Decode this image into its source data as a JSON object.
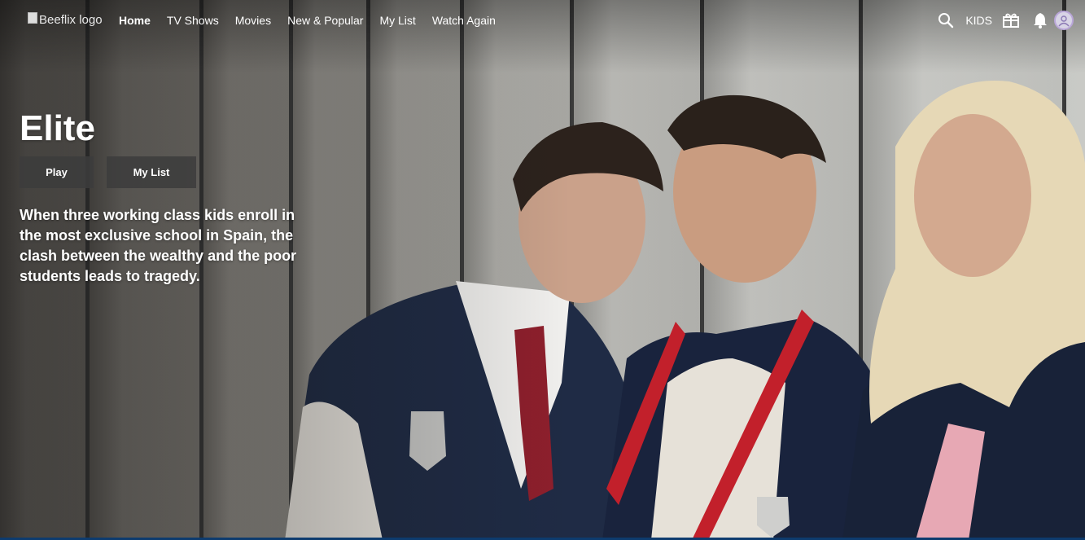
{
  "logo": {
    "alt_text": "Beeflix logo"
  },
  "nav": {
    "links": [
      {
        "label": "Home",
        "active": true
      },
      {
        "label": "TV Shows",
        "active": false
      },
      {
        "label": "Movies",
        "active": false
      },
      {
        "label": "New & Popular",
        "active": false
      },
      {
        "label": "My List",
        "active": false
      },
      {
        "label": "Watch Again",
        "active": false
      }
    ],
    "right": {
      "search_icon": "search-icon",
      "kids_label": "KIDS",
      "gift_icon": "gift-icon",
      "bell_icon": "bell-icon",
      "avatar_icon": "profile-avatar"
    }
  },
  "hero": {
    "title": "Elite",
    "play_label": "Play",
    "mylist_label": "My List",
    "description": "When three working class kids enroll in the most exclusive school in Spain, the clash between the wealthy and the poor students leads to tragedy."
  },
  "colors": {
    "button_bg": "#3c3c3c",
    "text": "#ffffff",
    "accent_line": "#0d3b6e"
  }
}
